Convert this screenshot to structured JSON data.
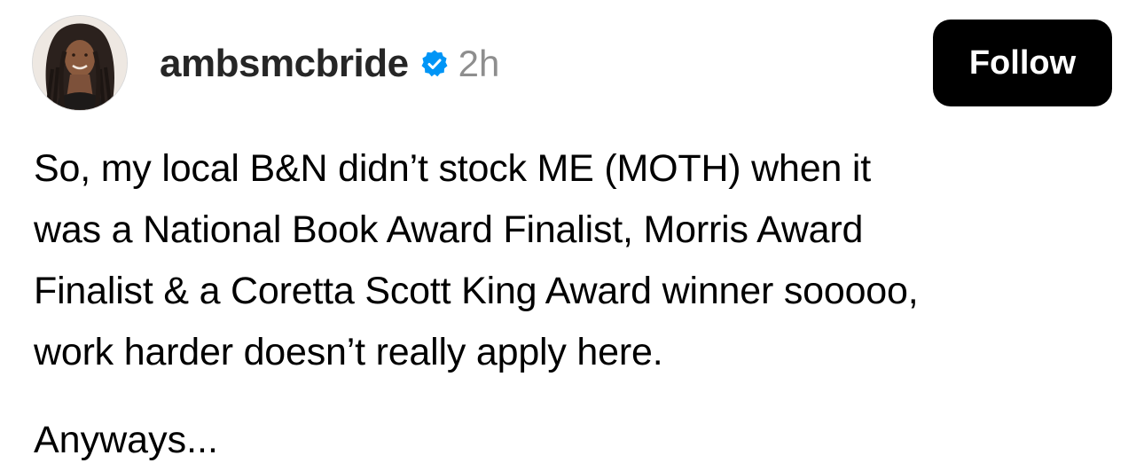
{
  "post": {
    "username": "ambsmcbride",
    "verified_icon": "verified-badge-icon",
    "timestamp": "2h",
    "follow_label": "Follow",
    "body_lines": [
      "So, my local B&N didn’t stock ME (MOTH) when it",
      "was a National Book Award Finalist, Morris Award",
      "Finalist & a Coretta Scott King Award winner sooooo,",
      "work harder doesn’t really apply here."
    ],
    "paragraph_2": "Anyways..."
  },
  "colors": {
    "verified_blue": "#0095f6",
    "follow_bg": "#000000",
    "timestamp_gray": "#8e8e8e"
  }
}
